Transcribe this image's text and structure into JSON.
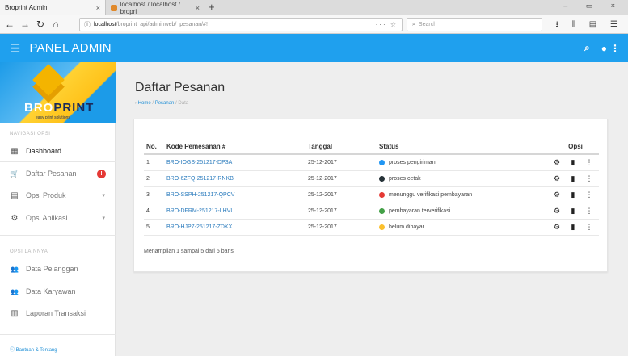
{
  "browser": {
    "tabs": [
      {
        "label": "Broprint Admin",
        "close": "×"
      },
      {
        "label": "localhost / localhost / bropri",
        "close": "×"
      }
    ],
    "new_tab": "+",
    "window_controls": "– ▭ ×",
    "url_host": "localhost",
    "url_path": "/broprint_api/adminweb/_pesanan/#!",
    "url_right": "··· ☆",
    "search_placeholder": "Search",
    "toolbar_icons": "⭳ ⫴ ▤ ☰"
  },
  "header": {
    "title": "PANEL ADMIN",
    "menu_icon": "☰",
    "search_icon": "⌕",
    "account_icon": "●",
    "more_icon": "⋮"
  },
  "sidebar": {
    "brand_a": "BRO",
    "brand_b": "PRINT",
    "brand_tagline": "easy print solutions",
    "section_nav": "NAVIGASI OPSI",
    "section_people": "OPSI LAINNYA",
    "items": [
      {
        "label": "Dashboard",
        "icon": "▦"
      },
      {
        "label": "Daftar Pesanan",
        "icon": "🛒",
        "badge": "!"
      },
      {
        "label": "Opsi Produk",
        "icon": "▤",
        "caret": "▾"
      },
      {
        "label": "Opsi Aplikasi",
        "icon": "⚙",
        "caret": "▾"
      },
      {
        "label": "Data Pelanggan",
        "icon": "👥"
      },
      {
        "label": "Data Karyawan",
        "icon": "👥"
      },
      {
        "label": "Laporan Transaksi",
        "icon": "▥"
      }
    ],
    "footer": "ⓘ Bantuan & Tentang"
  },
  "main": {
    "title": "Daftar Pesanan",
    "breadcrumb": {
      "home": "Home",
      "sep": " / ",
      "section": "Pesanan",
      "current": "Data"
    },
    "table": {
      "headers": {
        "no": "No.",
        "kode": "Kode Pemesanan #",
        "tanggal": "Tanggal",
        "status": "Status",
        "opsi": "Opsi"
      },
      "rows": [
        {
          "no": "1",
          "kode": "BRO-IOGS-251217-DP3A",
          "tanggal": "25-12-2017",
          "status": "proses pengiriman",
          "color": "#2196f3"
        },
        {
          "no": "2",
          "kode": "BRO-6ZFQ-251217-RNKB",
          "tanggal": "25-12-2017",
          "status": "proses cetak",
          "color": "#263238"
        },
        {
          "no": "3",
          "kode": "BRO-SSPH-251217-QPCV",
          "tanggal": "25-12-2017",
          "status": "menunggu verifikasi pembayaran",
          "color": "#e53935"
        },
        {
          "no": "4",
          "kode": "BRO-DFRM-251217-LHVU",
          "tanggal": "25-12-2017",
          "status": "pembayaran terverifikasi",
          "color": "#43a047"
        },
        {
          "no": "5",
          "kode": "BRO-HJP7-251217-ZDKX",
          "tanggal": "25-12-2017",
          "status": "belum dibayar",
          "color": "#fbc02d"
        }
      ],
      "actions": {
        "settings": "⚙",
        "delete": "▮",
        "more": "⋮"
      }
    },
    "summary": "Menampilan 1 sampai 5 dari 5 baris"
  }
}
